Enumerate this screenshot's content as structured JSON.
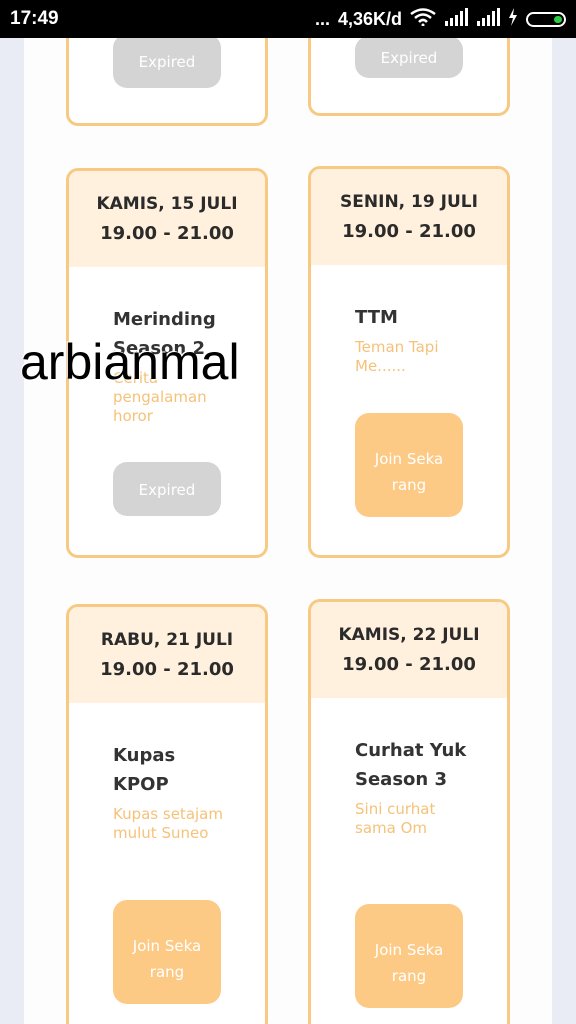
{
  "status_bar": {
    "time": "17:49",
    "network_speed": "4,36K/d",
    "dots": "...",
    "icons": [
      "wifi-icon",
      "signal-icon",
      "signal-icon",
      "charging-icon",
      "battery-icon"
    ]
  },
  "cards": [
    {
      "day": "",
      "time": "",
      "title": "",
      "desc": "",
      "button": "Expired",
      "status": "expired"
    },
    {
      "day": "",
      "time": "",
      "title": "",
      "desc": "",
      "button": "Expired",
      "status": "expired"
    },
    {
      "day": "KAMIS, 15 JULI",
      "time": "19.00 - 21.00",
      "title": "Merinding Season 2",
      "desc": "Cerita pengalaman horor",
      "button": "Expired",
      "status": "expired"
    },
    {
      "day": "SENIN, 19 JULI",
      "time": "19.00 - 21.00",
      "title": "TTM",
      "desc": "Teman Tapi Me......",
      "button": "Join Sekarang",
      "status": "join"
    },
    {
      "day": "RABU, 21 JULI",
      "time": "19.00 - 21.00",
      "title": "Kupas KPOP",
      "desc": "Kupas setajam mulut Suneo",
      "button": "Join Sekarang",
      "status": "join"
    },
    {
      "day": "KAMIS, 22 JULI",
      "time": "19.00 - 21.00",
      "title": "Curhat Yuk Season 3",
      "desc": "Sini curhat sama Om",
      "button": "Join Sekarang",
      "status": "join"
    }
  ],
  "watermark": "arbianmal",
  "colors": {
    "accent": "#f7c983",
    "header_bg": "#fff1de",
    "join_button": "#fdca86",
    "expired_button": "#d4d4d4",
    "desc_text": "#f5c27a"
  }
}
